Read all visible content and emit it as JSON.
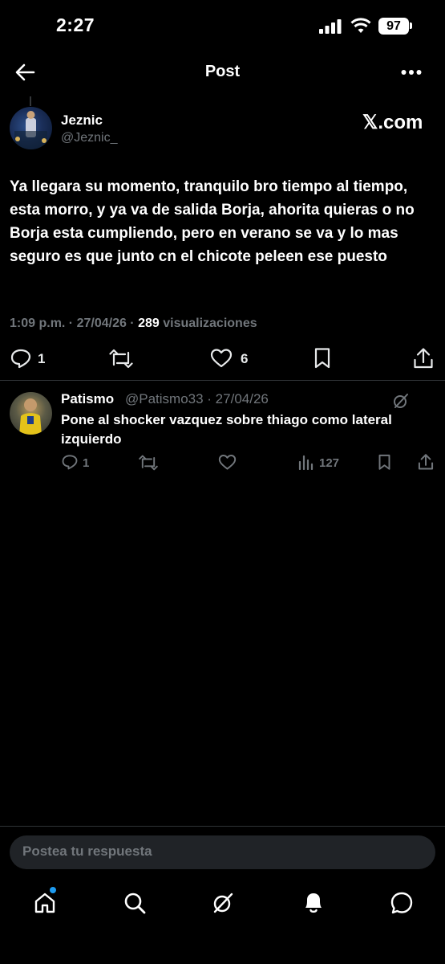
{
  "status_bar": {
    "time": "2:27",
    "battery": "97"
  },
  "header": {
    "title": "Post"
  },
  "post": {
    "author_name": "Jeznic",
    "author_handle": "@Jeznic_",
    "source_badge": "𝕏.com",
    "text": "Ya llegara su momento, tranquilo bro tiempo al tiempo, esta morro, y ya va de salida Borja, ahorita quieras o no Borja esta cumpliendo, pero en verano se va y lo mas seguro es que junto cn el chicote peleen ese puesto",
    "timestamp": "1:09 p.m. · 27/04/26 · ",
    "views_count": "289",
    "views_label": " visualizaciones",
    "reply_count": "1",
    "like_count": "6"
  },
  "reply": {
    "author_name": "Patismo",
    "author_meta": "@Patismo33 · 27/04/26",
    "text": "Pone al shocker vazquez sobre thiago como lateral izquierdo",
    "reply_count": "1",
    "views_count": "127"
  },
  "composer": {
    "placeholder": "Postea tu respuesta"
  },
  "bottom_nav": {
    "items": [
      "home-icon",
      "search-icon",
      "grok-icon",
      "notifications-icon",
      "messages-icon"
    ]
  },
  "colors": {
    "background": "#000000",
    "muted": "#71767b",
    "accent": "#1d9bf0"
  }
}
